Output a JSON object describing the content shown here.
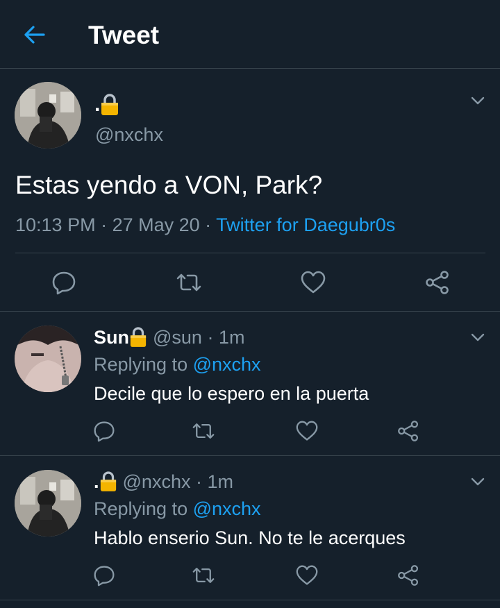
{
  "header": {
    "title": "Tweet",
    "back_icon": "arrow-left-icon",
    "accent": "#1da1f2"
  },
  "main_tweet": {
    "display_name": ".",
    "name_icon": "lock-icon",
    "handle": "@nxchx",
    "text": "Estas yendo a VON, Park?",
    "time": "10:13 PM",
    "date": "27 May 20",
    "source": "Twitter for Daegubr0s",
    "sep": " · "
  },
  "replies": [
    {
      "display_name": "Sun",
      "name_icon": "lock-icon",
      "handle": "@sun · 1m",
      "replying_label": "Replying to ",
      "replying_to": "@nxchx",
      "text": "Decile que lo espero en la puerta"
    },
    {
      "display_name": ".",
      "name_icon": "lock-icon",
      "handle": "@nxchx · 1m",
      "replying_label": "Replying to ",
      "replying_to": "@nxchx",
      "text": "Hablo enserio Sun. No te le acerques"
    }
  ],
  "colors": {
    "background": "#15202b",
    "divider": "#38444d",
    "secondary_text": "#8899a6",
    "link": "#1da1f2",
    "lock_body": "#f4b400"
  }
}
